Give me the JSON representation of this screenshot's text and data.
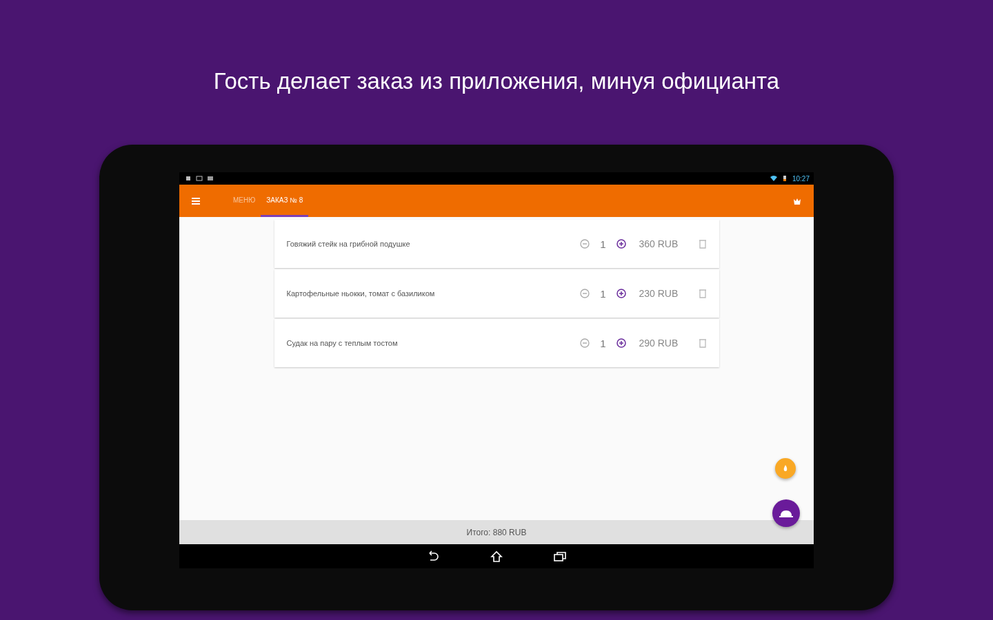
{
  "headline": "Гость делает заказ из приложения, минуя официанта",
  "status_bar": {
    "time": "10:27"
  },
  "toolbar": {
    "tabs": [
      {
        "label": "МЕНЮ",
        "selected": false
      },
      {
        "label": "ЗАКАЗ № 8",
        "selected": true
      }
    ]
  },
  "order_items": [
    {
      "name": "Говяжий стейк на грибной подушке",
      "quantity": "1",
      "price": "360 RUB"
    },
    {
      "name": "Картофельные ньокки, томат с базиликом",
      "quantity": "1",
      "price": "230 RUB"
    },
    {
      "name": "Судак на пару с теплым тостом",
      "quantity": "1",
      "price": "290 RUB"
    }
  ],
  "total": "Итого: 880 RUB"
}
